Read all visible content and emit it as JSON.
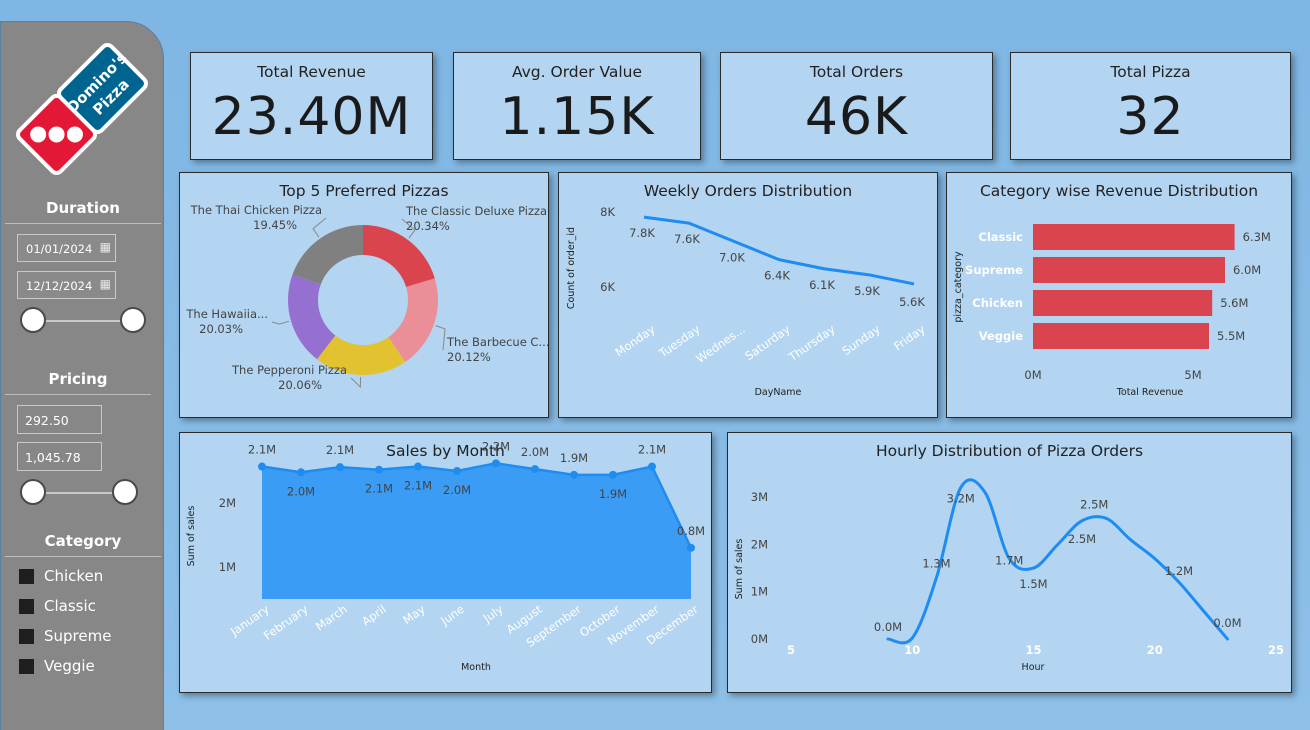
{
  "sidebar": {
    "logo_text": "Domino's Pizza",
    "duration": {
      "heading": "Duration",
      "start_date": "01/01/2024",
      "end_date": "12/12/2024"
    },
    "pricing": {
      "heading": "Pricing",
      "min": "292.50",
      "max": "1,045.78"
    },
    "category": {
      "heading": "Category",
      "items": [
        "Chicken",
        "Classic",
        "Supreme",
        "Veggie"
      ]
    }
  },
  "kpis": [
    {
      "title": "Total Revenue",
      "value": "23.40M"
    },
    {
      "title": "Avg. Order Value",
      "value": "1.15K"
    },
    {
      "title": "Total Orders",
      "value": "46K"
    },
    {
      "title": "Total Pizza",
      "value": "32"
    }
  ],
  "colors": {
    "accent_blue": "#1e8cf0",
    "area_blue": "#3a9cf5",
    "bar_red": "#d9444f",
    "panel_bg": "#b3d5f1"
  },
  "chart_data": [
    {
      "type": "pie",
      "title": "Top 5 Preferred Pizzas",
      "variant": "donut",
      "slices": [
        {
          "label": "The Classic Deluxe Pizza",
          "pct_label": "20.34%",
          "value": 20.34,
          "color": "#d9444f"
        },
        {
          "label": "The Barbecue C...",
          "pct_label": "20.12%",
          "value": 20.12,
          "color": "#ea8f97"
        },
        {
          "label": "The Pepperoni Pizza",
          "pct_label": "20.06%",
          "value": 20.06,
          "color": "#e3c22f"
        },
        {
          "label": "The Hawaiia...",
          "pct_label": "20.03%",
          "value": 20.03,
          "color": "#9570d0"
        },
        {
          "label": "The Thai Chicken Pizza",
          "pct_label": "19.45%",
          "value": 19.45,
          "color": "#808080"
        }
      ]
    },
    {
      "type": "line",
      "title": "Weekly Orders Distribution",
      "xlabel": "DayName",
      "ylabel": "Count of order_id",
      "categories": [
        "Monday",
        "Tuesday",
        "Wednes...",
        "Saturday",
        "Thursday",
        "Sunday",
        "Friday"
      ],
      "values": [
        7.8,
        7.6,
        7.0,
        6.4,
        6.1,
        5.9,
        5.6
      ],
      "value_labels": [
        "7.8K",
        "7.6K",
        "7.0K",
        "6.4K",
        "6.1K",
        "5.9K",
        "5.6K"
      ],
      "yticks": [
        "6K",
        "8K"
      ],
      "ylim": [
        5.5,
        8.0
      ],
      "color": "#1e8cf0"
    },
    {
      "type": "bar",
      "orientation": "horizontal",
      "title": "Category wise Revenue Distribution",
      "xlabel": "Total Revenue",
      "ylabel": "pizza_category",
      "categories": [
        "Classic",
        "Supreme",
        "Chicken",
        "Veggie"
      ],
      "values": [
        6.3,
        6.0,
        5.6,
        5.5
      ],
      "value_labels": [
        "6.3M",
        "6.0M",
        "5.6M",
        "5.5M"
      ],
      "xticks": [
        "0M",
        "5M"
      ],
      "color": "#d9444f"
    },
    {
      "type": "area",
      "title": "Sales by Month",
      "xlabel": "Month",
      "ylabel": "Sum of sales",
      "categories": [
        "January",
        "February",
        "March",
        "April",
        "May",
        "June",
        "July",
        "August",
        "September",
        "October",
        "November",
        "December"
      ],
      "values": [
        2.07,
        1.98,
        2.06,
        2.02,
        2.07,
        2.0,
        2.12,
        2.03,
        1.94,
        1.94,
        2.07,
        0.8
      ],
      "value_labels": [
        "2.1M",
        "2.0M",
        "2.1M",
        "2.1M",
        "2.1M",
        "2.0M",
        "2.2M",
        "2.0M",
        "1.9M",
        "1.9M",
        "2.1M",
        "0.8M"
      ],
      "yticks": [
        "1M",
        "2M"
      ],
      "ylim": [
        0,
        2.5
      ],
      "color": "#3a9cf5"
    },
    {
      "type": "line",
      "title": "Hourly Distribution of Pizza Orders",
      "xlabel": "Hour",
      "ylabel": "Sum of sales",
      "x": [
        9,
        10,
        11,
        12,
        13,
        14,
        15,
        16,
        17,
        18,
        19,
        20,
        21,
        22,
        23
      ],
      "values": [
        0.0,
        0.02,
        1.3,
        3.2,
        3.1,
        1.7,
        1.5,
        2.0,
        2.5,
        2.55,
        2.1,
        1.7,
        1.2,
        0.6,
        0.0
      ],
      "value_labels": [
        {
          "x": 9,
          "text": "0.0M"
        },
        {
          "x": 11,
          "text": "1.3M"
        },
        {
          "x": 12,
          "text": "3.2M"
        },
        {
          "x": 14,
          "text": "1.7M"
        },
        {
          "x": 15,
          "text": "1.5M"
        },
        {
          "x": 17,
          "text": "2.5M"
        },
        {
          "x": 18,
          "text": "2.5M"
        },
        {
          "x": 21,
          "text": "1.2M"
        },
        {
          "x": 23,
          "text": "0.0M"
        }
      ],
      "xticks": [
        "5",
        "10",
        "15",
        "20",
        "25"
      ],
      "yticks": [
        "0M",
        "1M",
        "2M",
        "3M"
      ],
      "xlim": [
        5,
        25
      ],
      "ylim": [
        0,
        3.5
      ],
      "color": "#1e8cf0"
    }
  ]
}
